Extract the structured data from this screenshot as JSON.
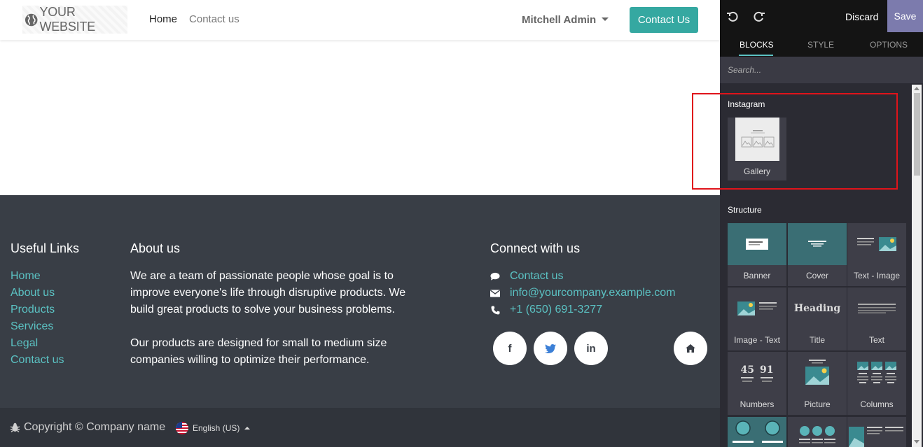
{
  "header": {
    "logo_text": "YOUR WEBSITE",
    "nav": [
      "Home",
      "Contact us"
    ],
    "user": "Mitchell Admin",
    "cta": "Contact Us"
  },
  "footer": {
    "useful_links": {
      "title": "Useful Links",
      "links": [
        "Home",
        "About us",
        "Products",
        "Services",
        "Legal",
        "Contact us"
      ]
    },
    "about": {
      "title": "About us",
      "paragraphs": [
        "We are a team of passionate people whose goal is to improve everyone's life through disruptive products. We build great products to solve your business problems.",
        "Our products are designed for small to medium size companies willing to optimize their performance."
      ]
    },
    "connect": {
      "title": "Connect with us",
      "contact": "Contact us",
      "email": "info@yourcompany.example.com",
      "phone": "+1 (650) 691-3277",
      "social_icons": [
        "facebook-icon",
        "twitter-icon",
        "linkedin-icon",
        "home-icon"
      ]
    },
    "copyright": "Copyright © Company name",
    "language": "English (US)"
  },
  "editor": {
    "discard": "Discard",
    "save": "Save",
    "tabs": [
      "BLOCKS",
      "STYLE",
      "OPTIONS"
    ],
    "search_placeholder": "Search...",
    "sections": [
      {
        "title": "Instagram",
        "blocks": [
          "Gallery"
        ]
      },
      {
        "title": "Structure",
        "blocks": [
          "Banner",
          "Cover",
          "Text - Image",
          "Image - Text",
          "Title",
          "Text",
          "Numbers",
          "Picture",
          "Columns"
        ]
      }
    ],
    "title_thumb_text": "Heading",
    "numbers_thumb": [
      "45",
      "91"
    ]
  },
  "colors": {
    "accent": "#35a8a1",
    "link": "#5bc2c3",
    "footer_bg": "#393e46",
    "panel_bg": "#2b2b33",
    "save_bg": "#7c7bad",
    "highlight": "#e0141b"
  }
}
